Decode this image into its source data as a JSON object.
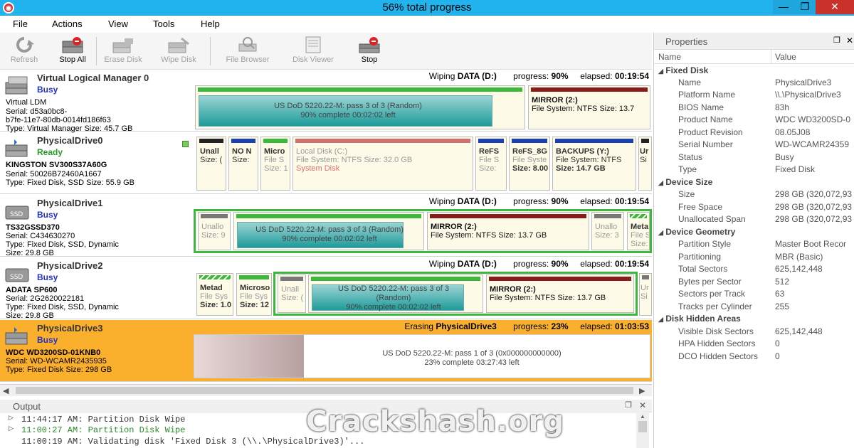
{
  "window": {
    "title": "56% total progress",
    "minimize": "—",
    "restore": "❐",
    "close": "✕"
  },
  "menu": [
    "File",
    "Actions",
    "View",
    "Tools",
    "Help"
  ],
  "toolbar": [
    {
      "label": "Refresh",
      "enabled": false
    },
    {
      "label": "Stop All",
      "enabled": true
    },
    {
      "label": "Erase Disk",
      "enabled": false
    },
    {
      "label": "Wipe Disk",
      "enabled": false
    },
    {
      "label": "File Browser",
      "enabled": false
    },
    {
      "label": "Disk Viewer",
      "enabled": false
    },
    {
      "label": "Stop",
      "enabled": true
    }
  ],
  "drives": [
    {
      "name": "Virtual Logical Manager 0",
      "status": "Busy",
      "lines": [
        "Virtual LDM",
        "Serial: d53a0bc8-",
        "b7fe-11e7-80db-0014fd186f63",
        "Type: Virtual Manager  Size: 45.7 GB"
      ],
      "op": "Wiping",
      "target": "DATA (D:)",
      "progress_label": "progress:",
      "progress": "90%",
      "elapsed_label": "elapsed:",
      "elapsed": "00:19:54",
      "wipe_text": [
        "US DoD 5220.22-M: pass 3 of 3 (Random)",
        "90% complete     00:02:02 left"
      ],
      "mirror": {
        "name": "MIRROR (2:)",
        "fs": "File System: NTFS Size: 13.7"
      }
    },
    {
      "name": "PhysicalDrive0",
      "status": "Ready",
      "lines": [
        "KINGSTON SV300S37A60G",
        "Serial: 50026B72460A1667",
        "Type: Fixed Disk, SSD   Size: 55.9 GB"
      ],
      "parts": [
        {
          "t1": "Unall",
          "t2": "Size: (",
          "color": "#222"
        },
        {
          "t1": "NO N",
          "t2": "Size:",
          "color": "#1a3fb0"
        },
        {
          "t1": "Micro",
          "t2": "File S",
          "t3": "Size: 1",
          "color": "#3cb83c"
        },
        {
          "t1": "Local Disk (C:)",
          "t2": "File System: NTFS Size: 32.0 GB",
          "t3": "System Disk",
          "color": "#d07070"
        },
        {
          "t1": "ReFS",
          "t2": "File S",
          "t3": "Size:",
          "color": "#1a3fb0"
        },
        {
          "t1": "ReFS_8G",
          "t2": "File Syste",
          "t3": "Size: 8.00",
          "color": "#1a3fb0"
        },
        {
          "t1": "BACKUPS (Y:)",
          "t2": "File System: NTFS",
          "t3": "Size: 14.7 GB",
          "color": "#1a3fb0"
        },
        {
          "t1": "Ur",
          "t2": "Si",
          "color": "#222"
        }
      ]
    },
    {
      "name": "PhysicalDrive1",
      "status": "Busy",
      "lines": [
        "TS32GSSD370",
        "Serial: C434630270",
        "Type: Fixed Disk, SSD, Dynamic",
        "Size: 29.8 GB"
      ],
      "op": "Wiping",
      "target": "DATA (D:)",
      "progress_label": "progress:",
      "progress": "90%",
      "elapsed_label": "elapsed:",
      "elapsed": "00:19:54",
      "unalloc": {
        "t1": "Unallo",
        "t2": "Size: 9"
      },
      "wipe_text": [
        "US DoD 5220.22-M: pass 3 of 3 (Random)",
        "90% complete     00:02:02 left"
      ],
      "mirror": {
        "name": "MIRROR (2:)",
        "fs": "File System: NTFS Size: 13.7 GB"
      },
      "unalloc2": {
        "t1": "Unallo",
        "t2": "Size: 3"
      },
      "meta": {
        "t1": "Meta",
        "t2": "File S",
        "t3": "Size:"
      }
    },
    {
      "name": "PhysicalDrive2",
      "status": "Busy",
      "lines": [
        "ADATA SP600",
        "Serial: 2G2620022181",
        "Type: Fixed Disk, SSD, Dynamic",
        "Size: 29.8 GB"
      ],
      "op": "Wiping",
      "target": "DATA (D:)",
      "progress_label": "progress:",
      "progress": "90%",
      "elapsed_label": "elapsed:",
      "elapsed": "00:19:54",
      "meta": {
        "t1": "Metad",
        "t2": "File Sys",
        "t3": "Size: 1.0"
      },
      "micro": {
        "t1": "Microso",
        "t2": "File Sys",
        "t3": "Size: 12"
      },
      "unalloc": {
        "t1": "Unall",
        "t2": "Size: ("
      },
      "wipe_text": [
        "US DoD 5220.22-M: pass 3 of 3",
        "(Random)",
        "90% complete    00:02:02 left"
      ],
      "mirror": {
        "name": "MIRROR (2:)",
        "fs": "File System: NTFS Size: 13.7 GB"
      },
      "tail": {
        "t1": "Ur",
        "t2": "Si"
      }
    },
    {
      "name": "PhysicalDrive3",
      "status": "Busy",
      "lines": [
        "WDC WD3200SD-01KNB0",
        "Serial: WD-WCAMR2435935",
        "Type: Fixed Disk   Size: 298 GB"
      ],
      "op": "Erasing",
      "target": "PhysicalDrive3",
      "progress_label": "progress:",
      "progress": "23%",
      "elapsed_label": "elapsed:",
      "elapsed": "01:03:53",
      "wipe_text": [
        "US DoD 5220.22-M: pass 1 of 3 (0x000000000000)",
        "23% complete     03:27:43 left"
      ]
    }
  ],
  "output": {
    "title": "Output",
    "lines": [
      {
        "text": "11:44:17 AM: Partition Disk Wipe",
        "color": "#333"
      },
      {
        "text": "11:00:27 AM: Partition Disk Wipe",
        "color": "#2a8a2a"
      },
      {
        "text": "11:00:19 AM: Validating disk 'Fixed Disk 3 (\\\\.\\PhysicalDrive3)'...",
        "color": "#333"
      }
    ]
  },
  "properties": {
    "title": "Properties",
    "col_name": "Name",
    "col_value": "Value",
    "groups": [
      {
        "name": "Fixed Disk",
        "rows": [
          [
            "Name",
            "PhysicalDrive3"
          ],
          [
            "Platform Name",
            "\\\\.\\PhysicalDrive3"
          ],
          [
            "BIOS Name",
            "83h"
          ],
          [
            "Product Name",
            "WDC WD3200SD-0"
          ],
          [
            "Product Revision",
            "08.05J08"
          ],
          [
            "Serial Number",
            "WD-WCAMR24359"
          ],
          [
            "Status",
            "Busy"
          ],
          [
            "Type",
            "Fixed Disk"
          ]
        ]
      },
      {
        "name": "Device Size",
        "rows": [
          [
            "Size",
            "298 GB (320,072,93"
          ],
          [
            "Free Space",
            "298 GB (320,072,93"
          ],
          [
            "Unallocated Span",
            "298 GB (320,072,93"
          ]
        ]
      },
      {
        "name": "Device Geometry",
        "rows": [
          [
            "Partition Style",
            "Master Boot Recor"
          ],
          [
            "Partitioning",
            "MBR (Basic)"
          ],
          [
            "Total Sectors",
            "625,142,448"
          ],
          [
            "Bytes per Sector",
            "512"
          ],
          [
            "Sectors per Track",
            "63"
          ],
          [
            "Tracks per Cylinder",
            "255"
          ]
        ]
      },
      {
        "name": "Disk Hidden Areas",
        "rows": [
          [
            "Visible Disk Sectors",
            "625,142,448"
          ],
          [
            "HPA Hidden Sectors",
            "0"
          ],
          [
            "DCO Hidden Sectors",
            "0"
          ]
        ]
      }
    ]
  },
  "watermark": "Crackshash.org"
}
